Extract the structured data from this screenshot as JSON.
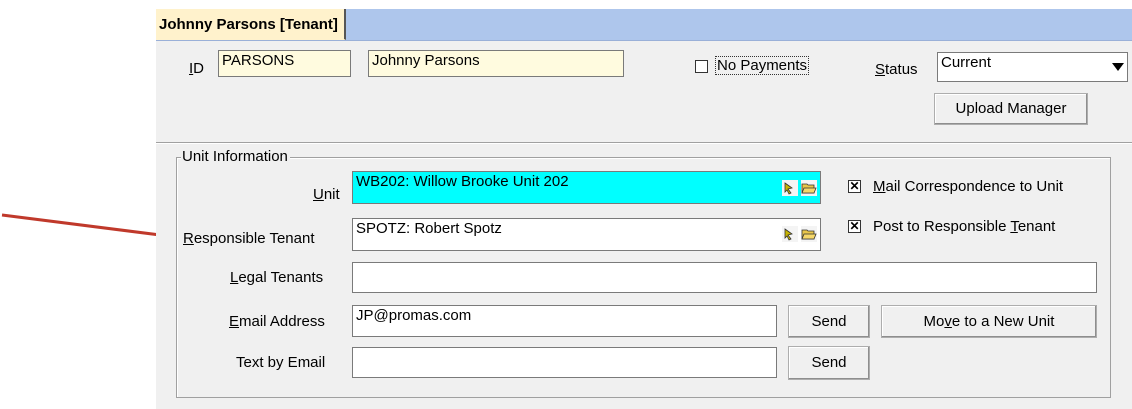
{
  "tab": {
    "label": "Johnny Parsons  [Tenant]"
  },
  "header": {
    "id_label": "ID",
    "id_value": "PARSONS",
    "name_value": "Johnny Parsons",
    "no_payments_label": "No Payments",
    "no_payments_checked": false,
    "status_label": "Status",
    "status_value": "Current",
    "upload_manager_label": "Upload Manager"
  },
  "unit_info": {
    "legend": "Unit Information",
    "unit_label": "Unit",
    "unit_value": "WB202: Willow Brooke Unit 202",
    "responsible_tenant_label": "Responsible Tenant",
    "responsible_tenant_value": "SPOTZ: Robert Spotz",
    "mail_correspondence_label": "Mail Correspondence to Unit",
    "mail_correspondence_checked": true,
    "post_responsible_label": "Post to Responsible Tenant",
    "post_responsible_checked": true,
    "legal_tenants_label": "Legal Tenants",
    "legal_tenants_value": "",
    "email_label": "Email Address",
    "email_value": "JP@promas.com",
    "email_send_label": "Send",
    "move_unit_label": "Move to a New Unit",
    "text_by_email_label": "Text by Email",
    "text_by_email_value": "",
    "text_send_label": "Send"
  },
  "colors": {
    "tabstrip": "#aec6ec",
    "tab": "#fff2cc",
    "unit_field": "#00ffff",
    "id_field": "#fffbdf",
    "arrow": "#c0392b"
  },
  "icons": {
    "picker": "arrow-picker-icon",
    "folder": "folder-open-icon",
    "dropdown": "chevron-down-icon",
    "annotation": "red-arrow"
  }
}
